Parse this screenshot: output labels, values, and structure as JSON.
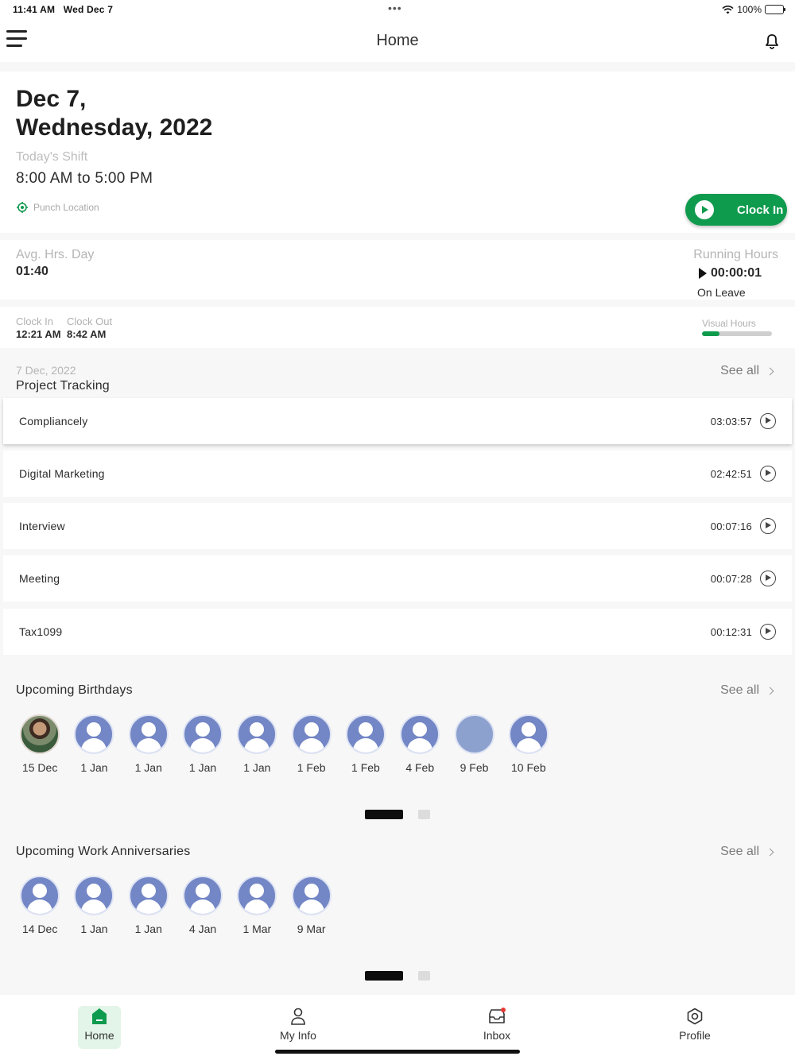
{
  "status_bar": {
    "time": "11:41 AM",
    "date": "Wed Dec 7",
    "battery": "100%"
  },
  "nav": {
    "title": "Home"
  },
  "today": {
    "date_line1": "Dec 7,",
    "date_line2": "Wednesday, 2022",
    "shift_label": "Today's Shift",
    "shift_time": "8:00 AM to 5:00 PM",
    "punch_location": "Punch Location",
    "clock_in_button": "Clock In"
  },
  "hours": {
    "avg_label": "Avg. Hrs. Day",
    "avg_value": "01:40",
    "running_label": "Running Hours",
    "running_value": "00:00:01",
    "status": "On Leave"
  },
  "clock": {
    "clock_in_label": "Clock In",
    "clock_in_value": "12:21 AM",
    "clock_out_label": "Clock Out",
    "clock_out_value": "8:42 AM",
    "visual_hours_label": "Visual Hours",
    "visual_hours_fraction": 0.25
  },
  "project_tracking": {
    "date": "7 Dec, 2022",
    "title": "Project Tracking",
    "see_all": "See all",
    "projects": [
      {
        "name": "Compliancely",
        "time": "03:03:57"
      },
      {
        "name": "Digital Marketing",
        "time": "02:42:51"
      },
      {
        "name": "Interview",
        "time": "00:07:16"
      },
      {
        "name": "Meeting",
        "time": "00:07:28"
      },
      {
        "name": "Tax1099",
        "time": "00:12:31"
      }
    ]
  },
  "birthdays": {
    "title": "Upcoming Birthdays",
    "see_all": "See all",
    "people": [
      {
        "date": "15 Dec",
        "avatar": "photo"
      },
      {
        "date": "1 Jan",
        "avatar": "default"
      },
      {
        "date": "1 Jan",
        "avatar": "default"
      },
      {
        "date": "1 Jan",
        "avatar": "default"
      },
      {
        "date": "1 Jan",
        "avatar": "default"
      },
      {
        "date": "1 Feb",
        "avatar": "default"
      },
      {
        "date": "1 Feb",
        "avatar": "default"
      },
      {
        "date": "4 Feb",
        "avatar": "default"
      },
      {
        "date": "9 Feb",
        "avatar": "blank"
      },
      {
        "date": "10 Feb",
        "avatar": "default"
      }
    ]
  },
  "anniversaries": {
    "title": "Upcoming Work Anniversaries",
    "see_all": "See all",
    "people": [
      {
        "date": "14 Dec",
        "avatar": "default"
      },
      {
        "date": "1 Jan",
        "avatar": "default"
      },
      {
        "date": "1 Jan",
        "avatar": "default"
      },
      {
        "date": "4 Jan",
        "avatar": "default"
      },
      {
        "date": "1 Mar",
        "avatar": "default"
      },
      {
        "date": "9 Mar",
        "avatar": "default"
      }
    ]
  },
  "tabs": [
    {
      "label": "Home",
      "icon": "home-icon",
      "active": true
    },
    {
      "label": "My Info",
      "icon": "person-icon",
      "active": false
    },
    {
      "label": "Inbox",
      "icon": "inbox-icon",
      "active": false
    },
    {
      "label": "Profile",
      "icon": "profile-icon",
      "active": false
    }
  ],
  "colors": {
    "accent": "#0f9b4e",
    "avatar": "#7386c5",
    "notification_dot": "#e53935"
  }
}
